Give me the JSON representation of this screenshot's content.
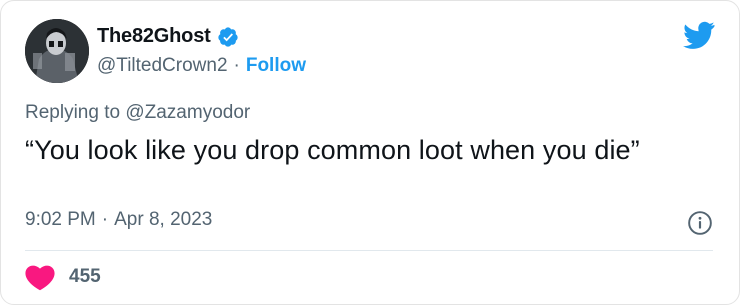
{
  "author": {
    "display_name": "The82Ghost",
    "handle": "@TiltedCrown2",
    "separator": "·",
    "follow_label": "Follow",
    "verified": true
  },
  "reply": {
    "prefix": "Replying to",
    "mention": "@Zazamyodor"
  },
  "tweet": {
    "text": "“You look like you drop common loot when you die”",
    "time": "9:02 PM",
    "separator": "·",
    "date": "Apr 8, 2023"
  },
  "engagement": {
    "likes": "455"
  },
  "icons": {
    "verified": "verified-badge-icon",
    "brand": "twitter-bird-icon",
    "info": "info-icon",
    "like": "heart-icon"
  },
  "colors": {
    "brand_blue": "#1d9bf0",
    "heart_pink": "#f91880",
    "secondary_text": "#536471",
    "primary_text": "#0f1419"
  }
}
